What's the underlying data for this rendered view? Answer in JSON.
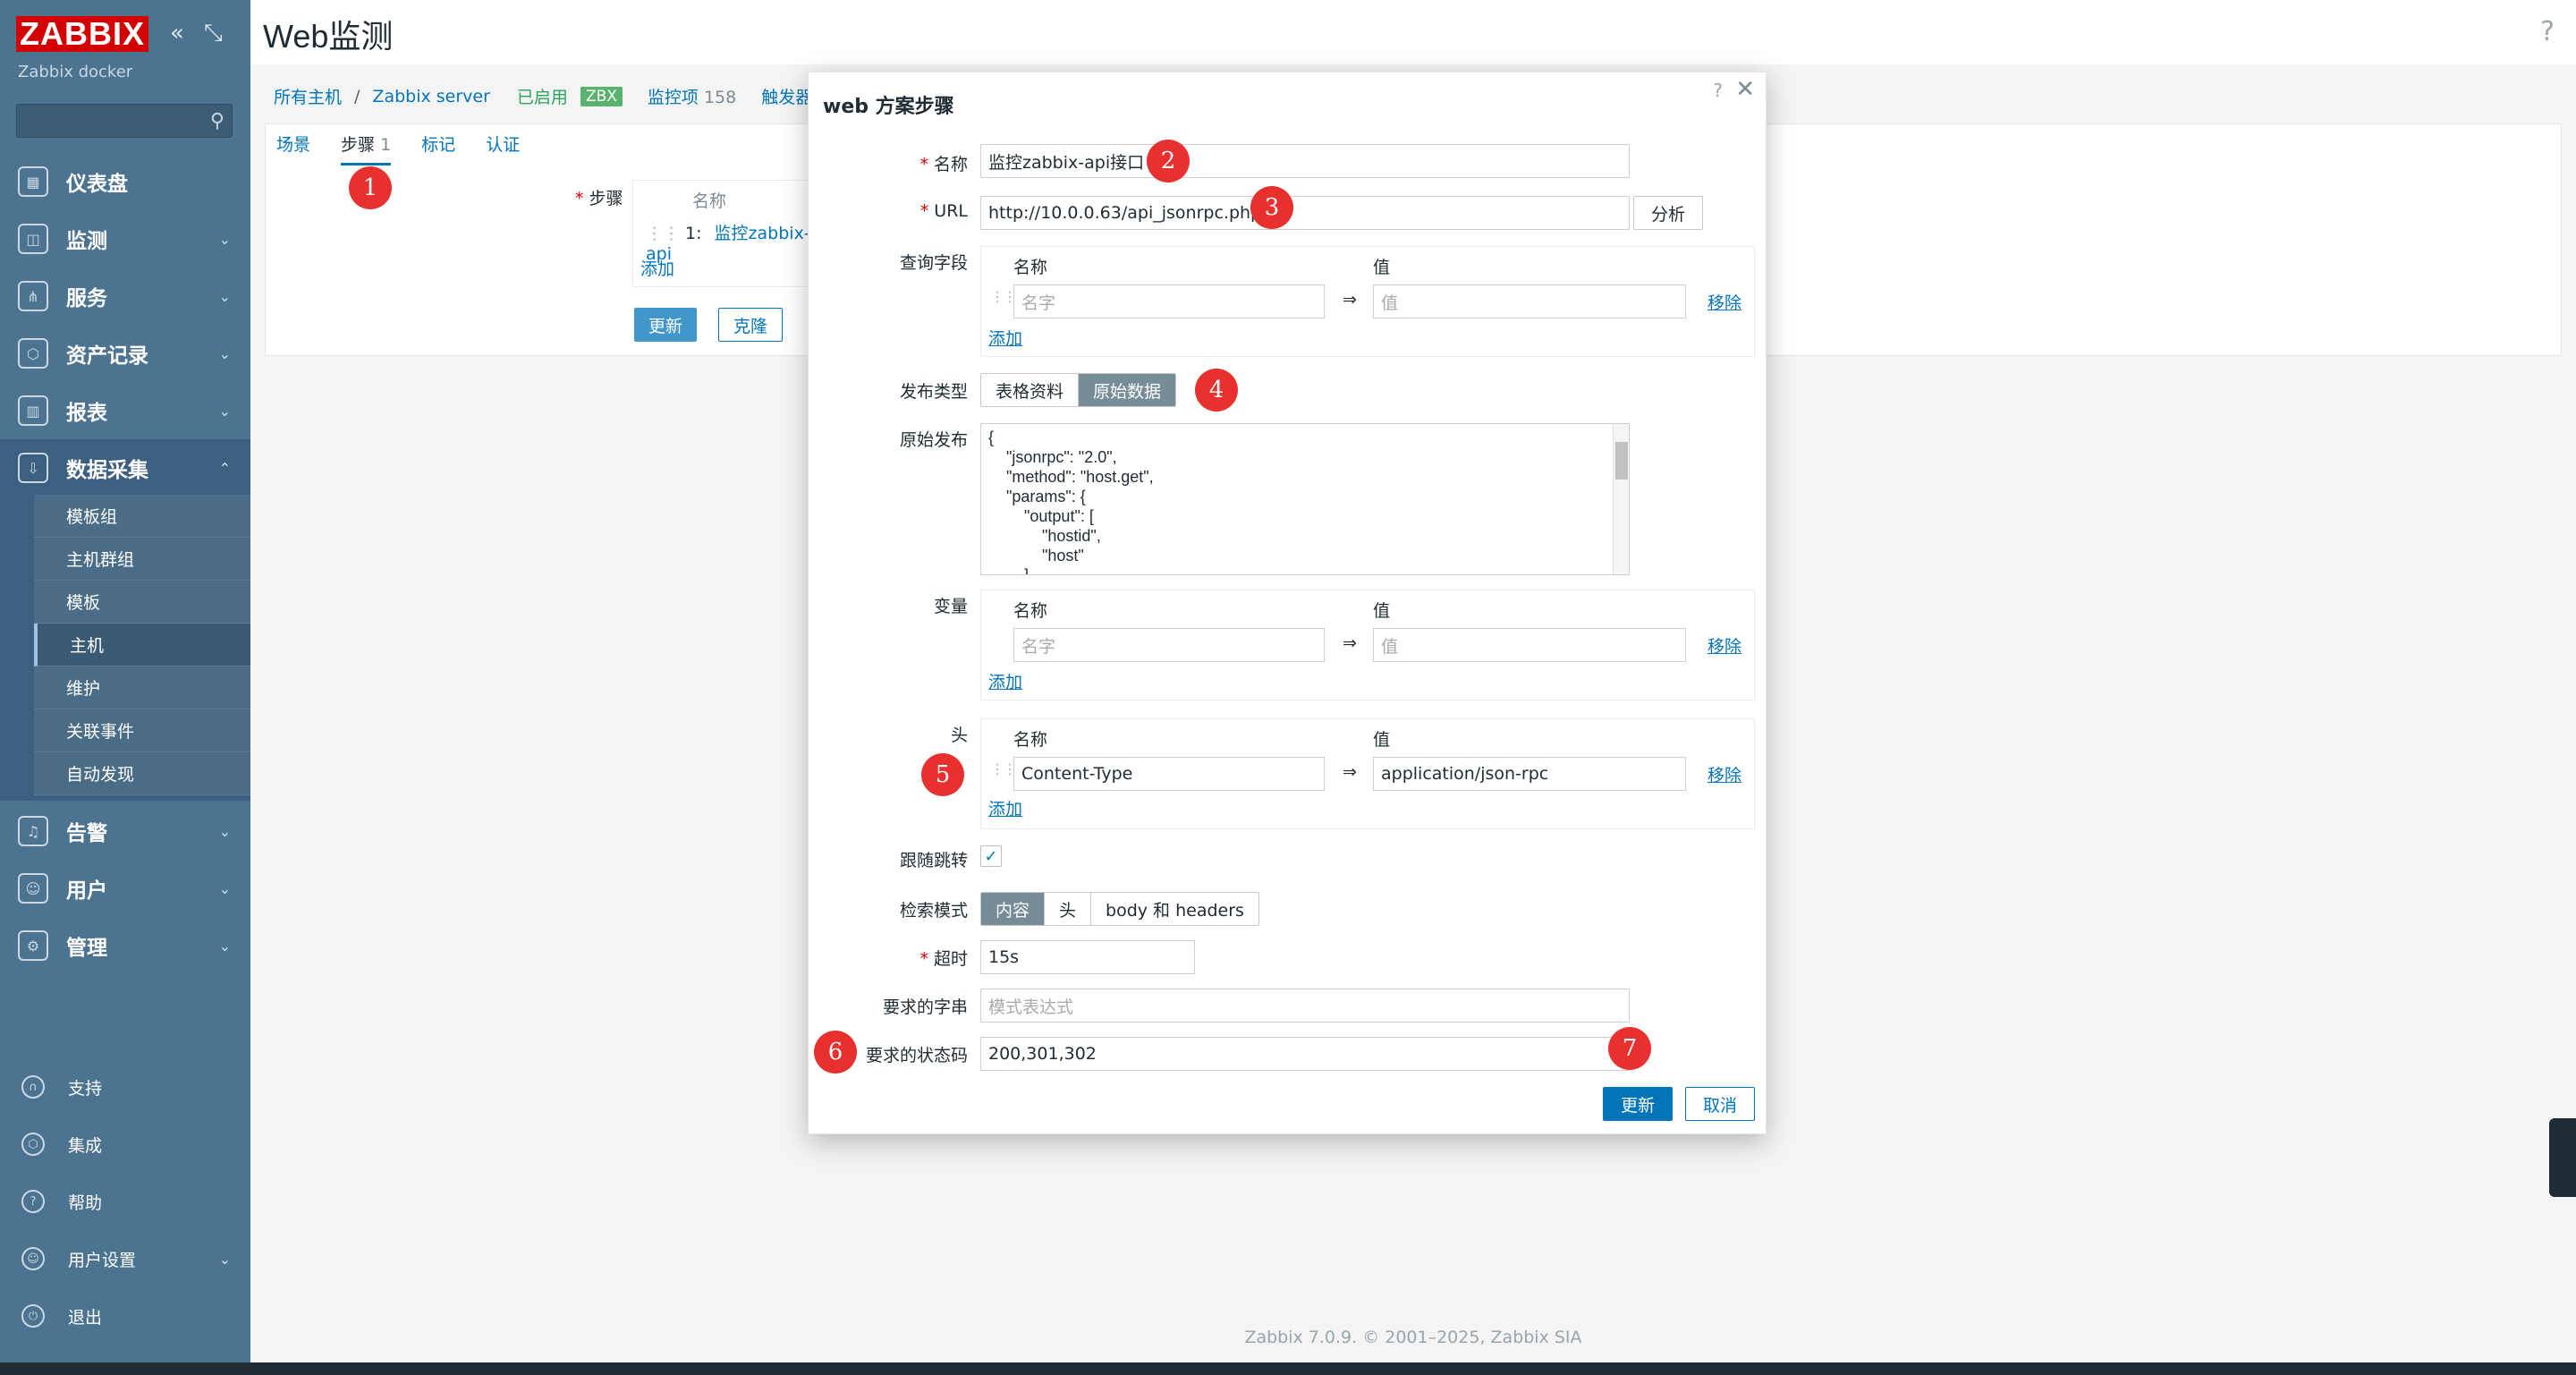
{
  "sidebar": {
    "logo": "ZABBIX",
    "server_name": "Zabbix docker",
    "menu": [
      {
        "label": "仪表盘",
        "icon": "dashboard-icon"
      },
      {
        "label": "监测",
        "icon": "monitoring-icon"
      },
      {
        "label": "服务",
        "icon": "services-icon"
      },
      {
        "label": "资产记录",
        "icon": "inventory-icon"
      },
      {
        "label": "报表",
        "icon": "reports-icon"
      },
      {
        "label": "数据采集",
        "icon": "data-collection-icon"
      },
      {
        "label": "告警",
        "icon": "alerts-icon"
      },
      {
        "label": "用户",
        "icon": "users-icon"
      },
      {
        "label": "管理",
        "icon": "administration-icon"
      }
    ],
    "submenu": [
      "模板组",
      "主机群组",
      "模板",
      "主机",
      "维护",
      "关联事件",
      "自动发现"
    ],
    "bottom": [
      "支持",
      "集成",
      "帮助",
      "用户设置",
      "退出"
    ]
  },
  "header": {
    "title": "Web监测",
    "help": "?"
  },
  "breadcrumb": {
    "all_hosts": "所有主机",
    "sep": "/",
    "host": "Zabbix server",
    "enabled": "已启用",
    "zbx": "ZBX",
    "items": "监控项",
    "items_count": "158",
    "triggers": "触发器"
  },
  "tabs": {
    "scenario": "场景",
    "steps": "步骤",
    "steps_count": "1",
    "tags": "标记",
    "auth": "认证"
  },
  "background_form": {
    "steps_label": "步骤",
    "name_header": "名称",
    "step_index": "1:",
    "step_name": "监控zabbix-api",
    "add": "添加",
    "update": "更新",
    "clone": "克隆"
  },
  "dialog": {
    "title": "web 方案步骤",
    "help": "?",
    "close": "✕",
    "name_label": "名称",
    "name_value": "监控zabbix-api接口",
    "url_label": "URL",
    "url_value": "http://10.0.0.63/api_jsonrpc.php",
    "parse_button": "分析",
    "query_label": "查询字段",
    "col_name": "名称",
    "col_value": "值",
    "name_placeholder": "名字",
    "value_placeholder": "值",
    "arrow": "⇒",
    "remove": "移除",
    "add": "添加",
    "post_type_label": "发布类型",
    "post_type_options": [
      "表格资料",
      "原始数据"
    ],
    "raw_post_label": "原始发布",
    "raw_post_lines": [
      "{",
      "    \"jsonrpc\": \"2.0\",",
      "    \"method\": \"host.get\",",
      "    \"params\": {",
      "        \"output\": [",
      "            \"hostid\",",
      "            \"host\"",
      "        ],"
    ],
    "variables_label": "变量",
    "headers_label": "头",
    "header_name": "Content-Type",
    "header_value": "application/json-rpc",
    "follow_redirects_label": "跟随跳转",
    "retrieve_mode_label": "检索模式",
    "retrieve_mode_options": [
      "内容",
      "头",
      "body 和 headers"
    ],
    "timeout_label": "超时",
    "timeout_value": "15s",
    "required_string_label": "要求的字串",
    "required_string_placeholder": "模式表达式",
    "status_codes_label": "要求的状态码",
    "status_codes_value": "200,301,302",
    "update_button": "更新",
    "cancel_button": "取消"
  },
  "markers": [
    "1",
    "2",
    "3",
    "4",
    "5",
    "6",
    "7"
  ],
  "footer": "Zabbix 7.0.9. © 2001–2025, Zabbix SIA",
  "colors": {
    "sidebar": "#4c7390",
    "accent": "#0275b8",
    "logo": "#d40000",
    "marker": "#e8302e"
  }
}
